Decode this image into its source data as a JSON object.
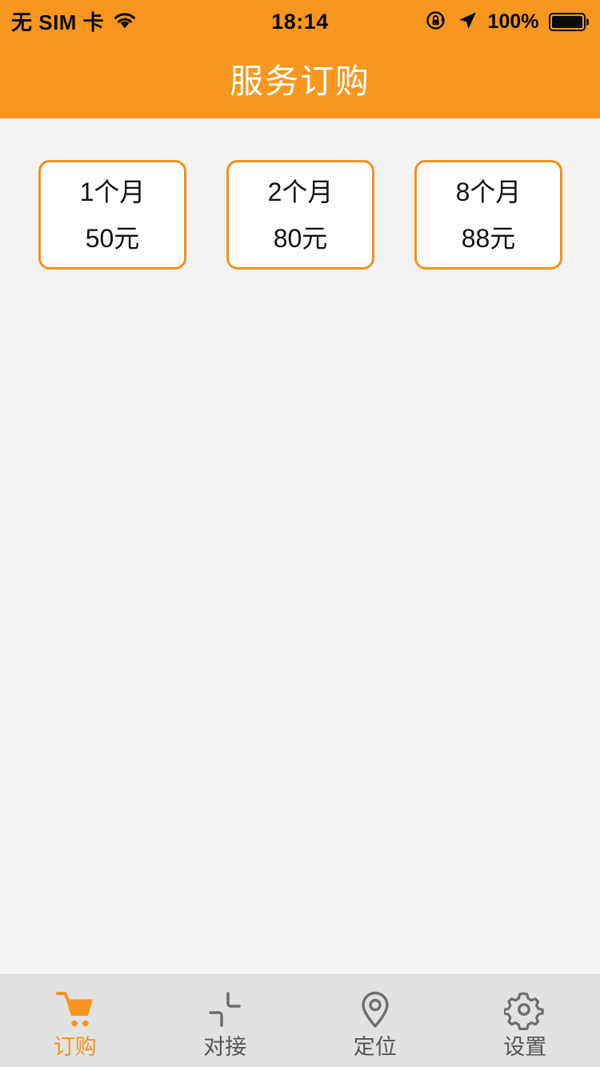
{
  "status_bar": {
    "carrier": "无 SIM 卡",
    "wifi_icon": "wifi-icon",
    "time": "18:14",
    "rotation_lock_icon": "rotation-lock-icon",
    "location_icon": "location-arrow-icon",
    "battery_percent": "100%",
    "battery_icon": "battery-full-icon",
    "battery_level": 100,
    "text_color": "#0A0A0A"
  },
  "header": {
    "title": "服务订购",
    "background_color": "#F8971F",
    "title_color": "#FFFFFF"
  },
  "theme": {
    "accent": "#F7941E",
    "card_border": "#F3921E",
    "content_background": "#F3F3F3",
    "tabbar_background": "#E2E2E2",
    "inactive_tab": "#555555"
  },
  "main": {
    "plans": [
      {
        "duration": "1个月",
        "price": "50元"
      },
      {
        "duration": "2个月",
        "price": "80元"
      },
      {
        "duration": "8个月",
        "price": "88元"
      }
    ]
  },
  "tabbar": {
    "items": [
      {
        "label": "订购",
        "icon": "shopping-cart-icon",
        "active": true
      },
      {
        "label": "对接",
        "icon": "docking-connect-icon",
        "active": false
      },
      {
        "label": "定位",
        "icon": "map-pin-icon",
        "active": false
      },
      {
        "label": "设置",
        "icon": "gear-icon",
        "active": false
      }
    ]
  }
}
